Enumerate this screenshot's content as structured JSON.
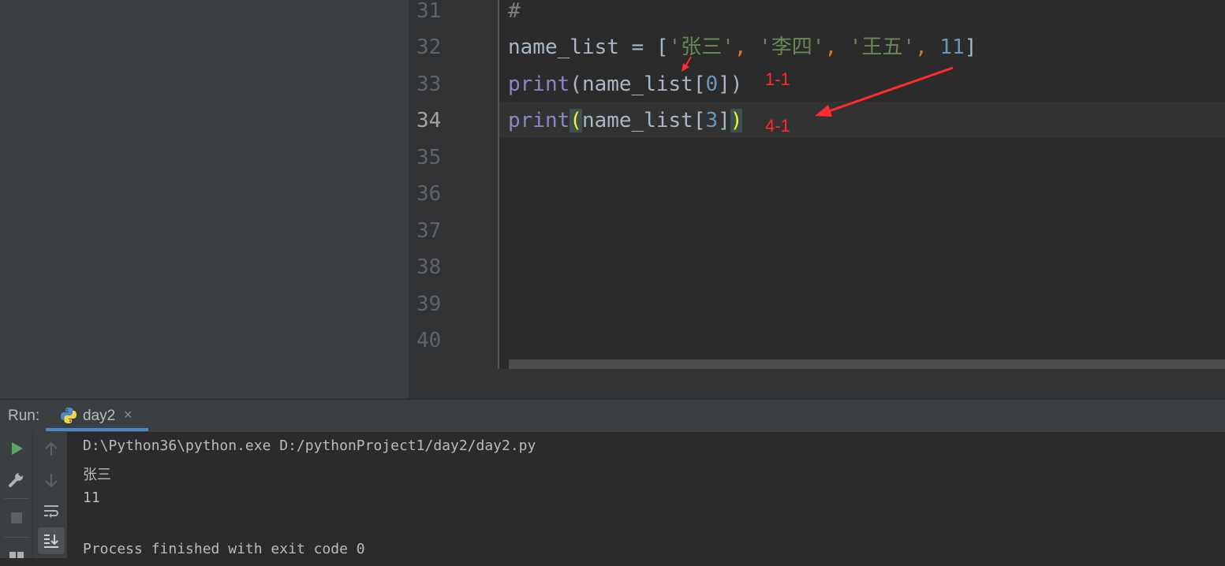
{
  "editor": {
    "line_numbers": [
      "31",
      "32",
      "33",
      "34",
      "35",
      "36",
      "37",
      "38",
      "39",
      "40"
    ],
    "active_line": "34",
    "line31": {
      "comment": "#"
    },
    "line32": {
      "ident": "name_list",
      "op": " = ",
      "open": "[",
      "s1": "'张三'",
      "comma1": ", ",
      "s2": "'李四'",
      "comma2": ", ",
      "s3": "'王五'",
      "comma3": ", ",
      "num": "11",
      "close": "]"
    },
    "line33": {
      "fn": "print",
      "open": "(",
      "arg": "name_list[",
      "idx": "0",
      "close_bracket": "]",
      "close": ")"
    },
    "line34": {
      "fn": "print",
      "open": "(",
      "arg": "name_list[",
      "idx": "3",
      "close_bracket": "]",
      "close": ")"
    },
    "annotations": {
      "first": "1-1",
      "second": "4-1"
    }
  },
  "run_panel": {
    "label": "Run:",
    "tab_label": "day2",
    "tab_close": "×",
    "icons": [
      "run-icon",
      "wrench-icon",
      "stop-icon",
      "layout-icon",
      "arrow-up-icon",
      "arrow-down-icon",
      "soft-wrap-icon",
      "scroll-to-end-icon"
    ],
    "console": {
      "command": "D:\\Python36\\python.exe D:/pythonProject1/day2/day2.py",
      "out1": "张三",
      "out2": "11",
      "blank": "",
      "exit": "Process finished with exit code 0"
    }
  },
  "colors": {
    "string": "#6a8759",
    "number": "#6897bb",
    "builtin": "#8888c6",
    "annotation": "#ff2a2a",
    "run_green": "#59a869",
    "tab_underline": "#4a88c7"
  }
}
